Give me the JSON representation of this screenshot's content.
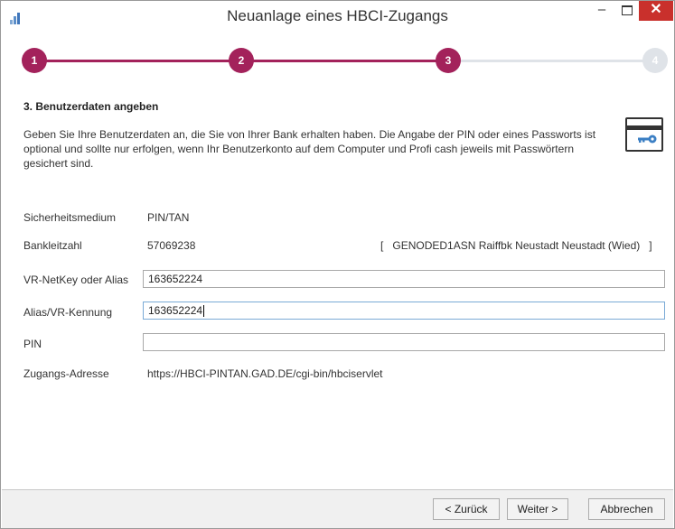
{
  "window": {
    "title": "Neuanlage eines HBCI-Zugangs",
    "close_glyph": "✕",
    "minimize_glyph": "–"
  },
  "steps": [
    {
      "label": "1",
      "state": "done"
    },
    {
      "label": "2",
      "state": "done"
    },
    {
      "label": "3",
      "state": "current"
    },
    {
      "label": "4",
      "state": "pending"
    }
  ],
  "colors": {
    "accent": "#a3225b",
    "inactive": "#dfe3e8",
    "close": "#c9302c"
  },
  "section": {
    "heading": "3. Benutzerdaten angeben",
    "description": "Geben Sie Ihre Benutzerdaten an, die Sie von Ihrer Bank erhalten haben. Die Angabe der PIN oder eines Passworts ist optional und sollte nur erfolgen, wenn Ihr Benutzerkonto auf dem Computer und Profi cash jeweils mit Passwörtern gesichert sind.",
    "icon": "card-key-icon"
  },
  "form": {
    "security_medium": {
      "label": "Sicherheitsmedium",
      "value": "PIN/TAN"
    },
    "bank_code": {
      "label": "Bankleitzahl",
      "value": "57069238",
      "bank_info": "GENODED1ASN Raiffbk Neustadt Neustadt (Wied)",
      "bracket_open": "[",
      "bracket_close": "]"
    },
    "netkey": {
      "label": "VR-NetKey oder Alias",
      "value": "163652224"
    },
    "alias": {
      "label": "Alias/VR-Kennung",
      "value": "163652224"
    },
    "pin": {
      "label": "PIN",
      "value": ""
    },
    "address": {
      "label": "Zugangs-Adresse",
      "value": "https://HBCI-PINTAN.GAD.DE/cgi-bin/hbciservlet"
    }
  },
  "buttons": {
    "back": "< Zurück",
    "next": "Weiter >",
    "cancel": "Abbrechen"
  }
}
